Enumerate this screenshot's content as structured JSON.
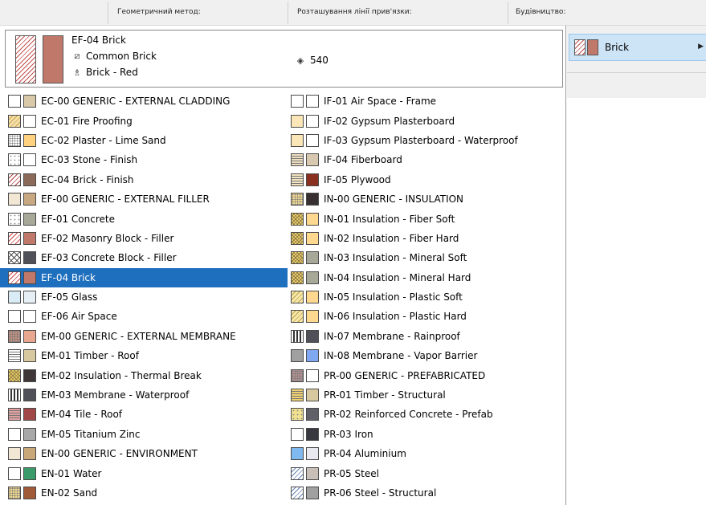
{
  "header": {
    "col1": "Геометричний метод:",
    "col2": "Розташування лінії прив'язки:",
    "col3": "Будівництво:"
  },
  "info": {
    "name": "EF-04 Brick",
    "fill": "Common Brick",
    "material": "Brick - Red",
    "priority": "540",
    "hatch_color": "#c0504d",
    "fill_color": "#c0786a"
  },
  "right_panel": {
    "selected_label": "Brick"
  },
  "colors": {
    "selection": "#1f6fbf",
    "hover": "#cde4f7"
  },
  "left_items": [
    {
      "label": "EC-00  GENERIC - EXTERNAL CLADDING",
      "pattern": "none",
      "pcolor": "#fff",
      "color": "#d9c9a8"
    },
    {
      "label": "EC-01  Fire Proofing",
      "pattern": "diag",
      "pcolor": "#c8a050",
      "color": "#ffffff",
      "pbg": "#f4e0a8"
    },
    {
      "label": "EC-02  Plaster - Lime Sand",
      "pattern": "dots",
      "pcolor": "#777",
      "color": "#ffd27f"
    },
    {
      "label": "EC-03  Stone - Finish",
      "pattern": "sparse",
      "pcolor": "#888",
      "color": "#ffffff"
    },
    {
      "label": "EC-04  Brick - Finish",
      "pattern": "diag",
      "pcolor": "#b04040",
      "color": "#8b6a5a"
    },
    {
      "label": "EF-00  GENERIC - EXTERNAL FILLER",
      "pattern": "none",
      "pcolor": "#fff",
      "color": "#c8a880",
      "pbg": "#f2e6d4"
    },
    {
      "label": "EF-01  Concrete",
      "pattern": "sparse",
      "pcolor": "#888",
      "color": "#a8a898"
    },
    {
      "label": "EF-02  Masonry Block - Filler",
      "pattern": "diag",
      "pcolor": "#c44",
      "color": "#c0786a"
    },
    {
      "label": "EF-03  Concrete Block - Filler",
      "pattern": "cross",
      "pcolor": "#555",
      "color": "#505058"
    },
    {
      "label": "EF-04  Brick",
      "pattern": "diag",
      "pcolor": "#c44",
      "color": "#c0786a",
      "selected": true
    },
    {
      "label": "EF-05  Glass",
      "pattern": "none",
      "pcolor": "#fff",
      "color": "#e6f0f4",
      "pbg": "#d9ecf5"
    },
    {
      "label": "EF-06  Air Space",
      "pattern": "none",
      "pcolor": "#fff",
      "color": "#ffffff"
    },
    {
      "label": "EM-00  GENERIC - EXTERNAL MEMBRANE",
      "pattern": "dots",
      "pcolor": "#777",
      "color": "#e8a890",
      "pbg": "#c09080"
    },
    {
      "label": "EM-01  Timber - Roof",
      "pattern": "hlines",
      "pcolor": "#777",
      "color": "#d8c8a0"
    },
    {
      "label": "EM-02  Insulation - Thermal Break",
      "pattern": "wave",
      "pcolor": "#8a7a40",
      "color": "#403838",
      "pbg": "#f0d070"
    },
    {
      "label": "EM-03  Membrane - Waterproof",
      "pattern": "vlines",
      "pcolor": "#333",
      "color": "#505058"
    },
    {
      "label": "EM-04  Tile - Roof",
      "pattern": "hlines",
      "pcolor": "#6a2020",
      "color": "#a04848",
      "pbg": "#e0a0a0"
    },
    {
      "label": "EM-05  Titanium Zinc",
      "pattern": "none",
      "pcolor": "#fff",
      "color": "#a8a8a8"
    },
    {
      "label": "EN-00  GENERIC - ENVIRONMENT",
      "pattern": "none",
      "pcolor": "#fff",
      "color": "#c8a878",
      "pbg": "#f2e6d4"
    },
    {
      "label": "EN-01  Water",
      "pattern": "none",
      "pcolor": "#fff",
      "color": "#3a9a6a"
    },
    {
      "label": "EN-02  Sand",
      "pattern": "dots",
      "pcolor": "#777",
      "color": "#a05a38",
      "pbg": "#f0d890"
    }
  ],
  "right_items": [
    {
      "label": "IF-01  Air Space - Frame",
      "pattern": "none",
      "pcolor": "#fff",
      "color": "#ffffff"
    },
    {
      "label": "IF-02  Gypsum Plasterboard",
      "pattern": "none",
      "pcolor": "#fff",
      "color": "#ffffff",
      "pbg": "#fbe6b8"
    },
    {
      "label": "IF-03  Gypsum Plasterboard - Waterproof",
      "pattern": "none",
      "pcolor": "#fff",
      "color": "#ffffff",
      "pbg": "#fbe6b8"
    },
    {
      "label": "IF-04  Fiberboard",
      "pattern": "hlines",
      "pcolor": "#999",
      "color": "#d8c8b0",
      "pbg": "#f0e0c0"
    },
    {
      "label": "IF-05  Plywood",
      "pattern": "hlines",
      "pcolor": "#999",
      "color": "#8a3020",
      "pbg": "#f4e4c0"
    },
    {
      "label": "IN-00  GENERIC - INSULATION",
      "pattern": "dots",
      "pcolor": "#777",
      "color": "#383030",
      "pbg": "#f0d890"
    },
    {
      "label": "IN-01  Insulation - Fiber Soft",
      "pattern": "wave",
      "pcolor": "#8a7a40",
      "color": "#ffd890",
      "pbg": "#f0d070"
    },
    {
      "label": "IN-02  Insulation - Fiber Hard",
      "pattern": "wave",
      "pcolor": "#8a7a40",
      "color": "#ffd890",
      "pbg": "#f0d070"
    },
    {
      "label": "IN-03  Insulation - Mineral Soft",
      "pattern": "wave",
      "pcolor": "#8a7a40",
      "color": "#a8a898",
      "pbg": "#f0d070"
    },
    {
      "label": "IN-04  Insulation - Mineral Hard",
      "pattern": "wave",
      "pcolor": "#8a7a40",
      "color": "#a8a898",
      "pbg": "#f0d070"
    },
    {
      "label": "IN-05  Insulation - Plastic Soft",
      "pattern": "diag",
      "pcolor": "#b8a050",
      "color": "#ffd890",
      "pbg": "#f8e8a8"
    },
    {
      "label": "IN-06  Insulation - Plastic Hard",
      "pattern": "diag",
      "pcolor": "#b8a050",
      "color": "#ffd890",
      "pbg": "#f8e8a8"
    },
    {
      "label": "IN-07  Membrane - Rainproof",
      "pattern": "vlines",
      "pcolor": "#333",
      "color": "#505058"
    },
    {
      "label": "IN-08  Membrane - Vapor Barrier",
      "pattern": "none",
      "pcolor": "#fff",
      "color": "#80a8f0",
      "pbg": "#a0a0a0"
    },
    {
      "label": "PR-00  GENERIC - PREFABRICATED",
      "pattern": "dots",
      "pcolor": "#666",
      "color": "#ffffff",
      "pbg": "#b09090"
    },
    {
      "label": "PR-01  Timber - Structural",
      "pattern": "hlines",
      "pcolor": "#a08030",
      "color": "#d8c8a0",
      "pbg": "#f0d070"
    },
    {
      "label": "PR-02  Reinforced Concrete - Prefab",
      "pattern": "sparse",
      "pcolor": "#888",
      "color": "#606068",
      "pbg": "#f0e090"
    },
    {
      "label": "PR-03  Iron",
      "pattern": "none",
      "pcolor": "#fff",
      "color": "#383840"
    },
    {
      "label": "PR-04  Aluminium",
      "pattern": "none",
      "pcolor": "#fff",
      "color": "#e8e8f0",
      "pbg": "#80b8f0"
    },
    {
      "label": "PR-05  Steel",
      "pattern": "diag",
      "pcolor": "#6080b0",
      "color": "#c8c0b8",
      "pbg": "#ffffff"
    },
    {
      "label": "PR-06  Steel - Structural",
      "pattern": "diag",
      "pcolor": "#6080b0",
      "color": "#a0a0a0",
      "pbg": "#ffffff"
    }
  ]
}
